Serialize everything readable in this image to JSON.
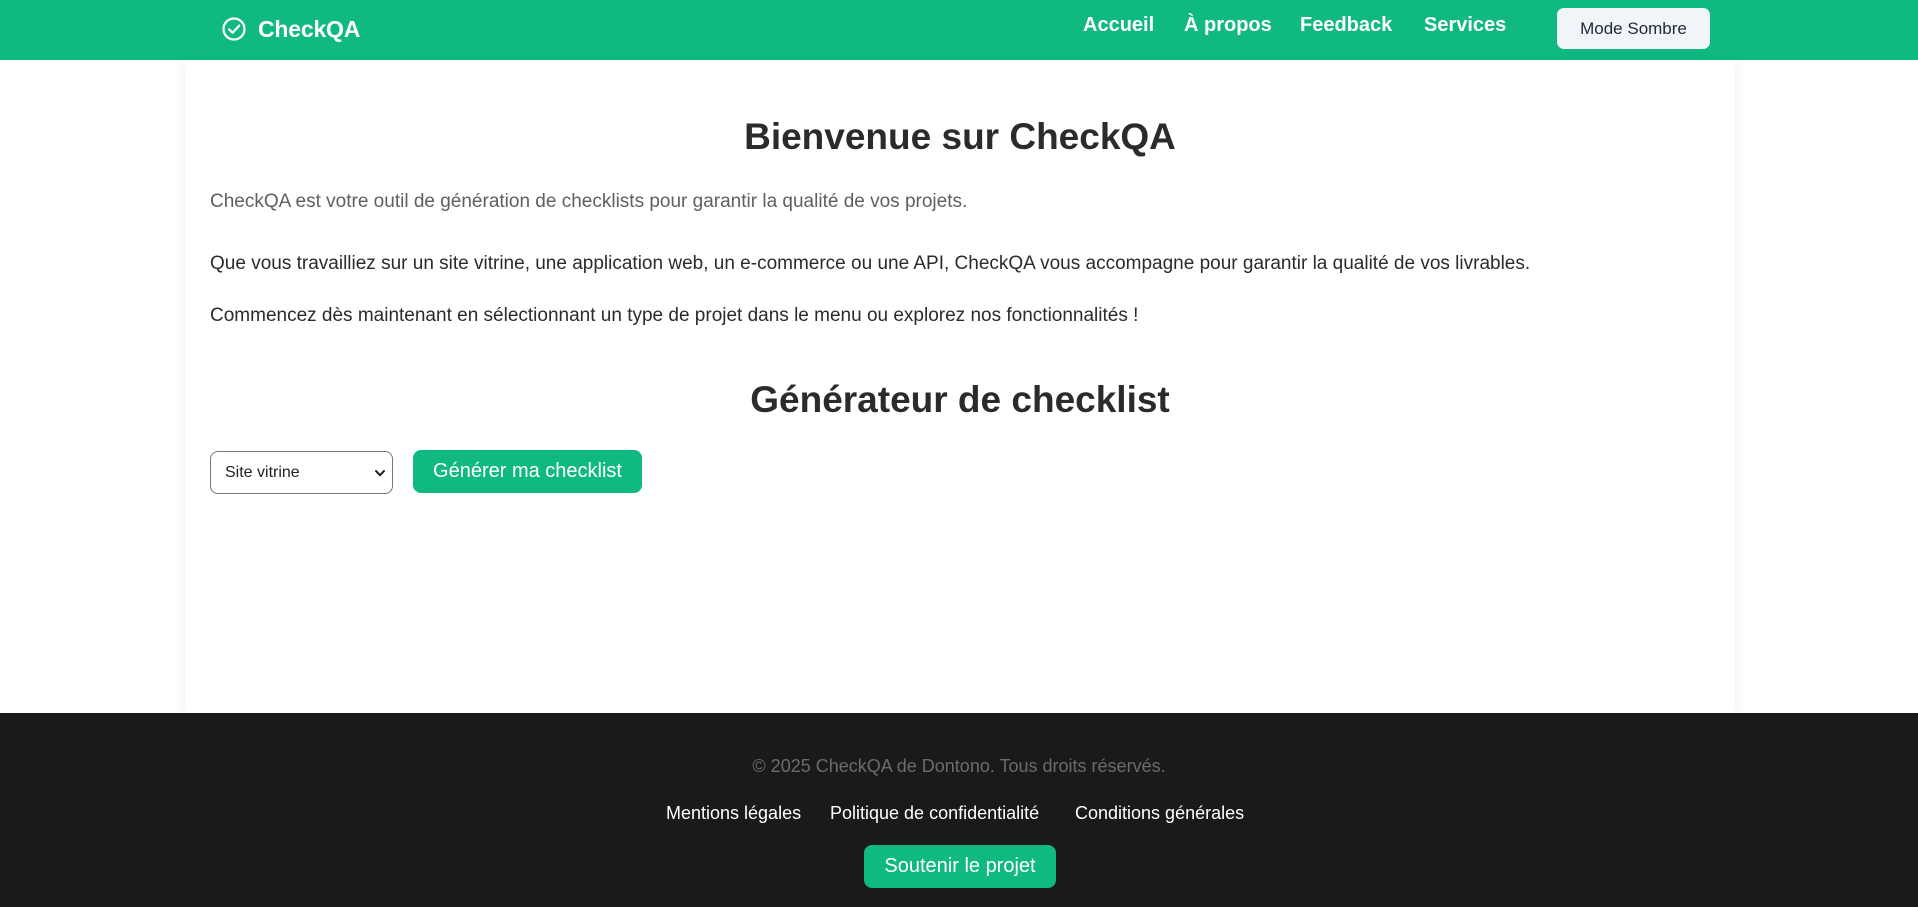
{
  "header": {
    "brand": {
      "name": "CheckQA",
      "icon": "check-circle-icon"
    },
    "nav": [
      {
        "label": "Accueil"
      },
      {
        "label": "À propos"
      },
      {
        "label": "Feedback"
      },
      {
        "label": "Services"
      }
    ],
    "dark_mode_label": "Mode Sombre"
  },
  "main": {
    "title": "Bienvenue sur CheckQA",
    "lead": "CheckQA est votre outil de génération de checklists pour garantir la qualité de vos projets.",
    "paragraphs": [
      "Que vous travailliez sur un site vitrine, une application web, un e-commerce ou une API, CheckQA vous accompagne pour garantir la qualité de vos livrables.",
      "Commencez dès maintenant en sélectionnant un type de projet dans le menu ou explorez nos fonctionnalités !"
    ],
    "generator": {
      "title": "Générateur de checklist",
      "project_type_selected": "Site vitrine",
      "button_label": "Générer ma checklist"
    }
  },
  "footer": {
    "copyright": "© 2025 CheckQA de Dontono. Tous droits réservés.",
    "links": [
      {
        "label": "Mentions légales"
      },
      {
        "label": "Politique de confidentialité"
      },
      {
        "label": "Conditions générales"
      }
    ],
    "support_label": "Soutenir le projet"
  },
  "colors": {
    "primary": "#10b981",
    "footer_background": "#1a1a1a",
    "text": "#2b2b2b",
    "muted_text": "#5f5f5f",
    "button_light": "#f1f5f9"
  }
}
